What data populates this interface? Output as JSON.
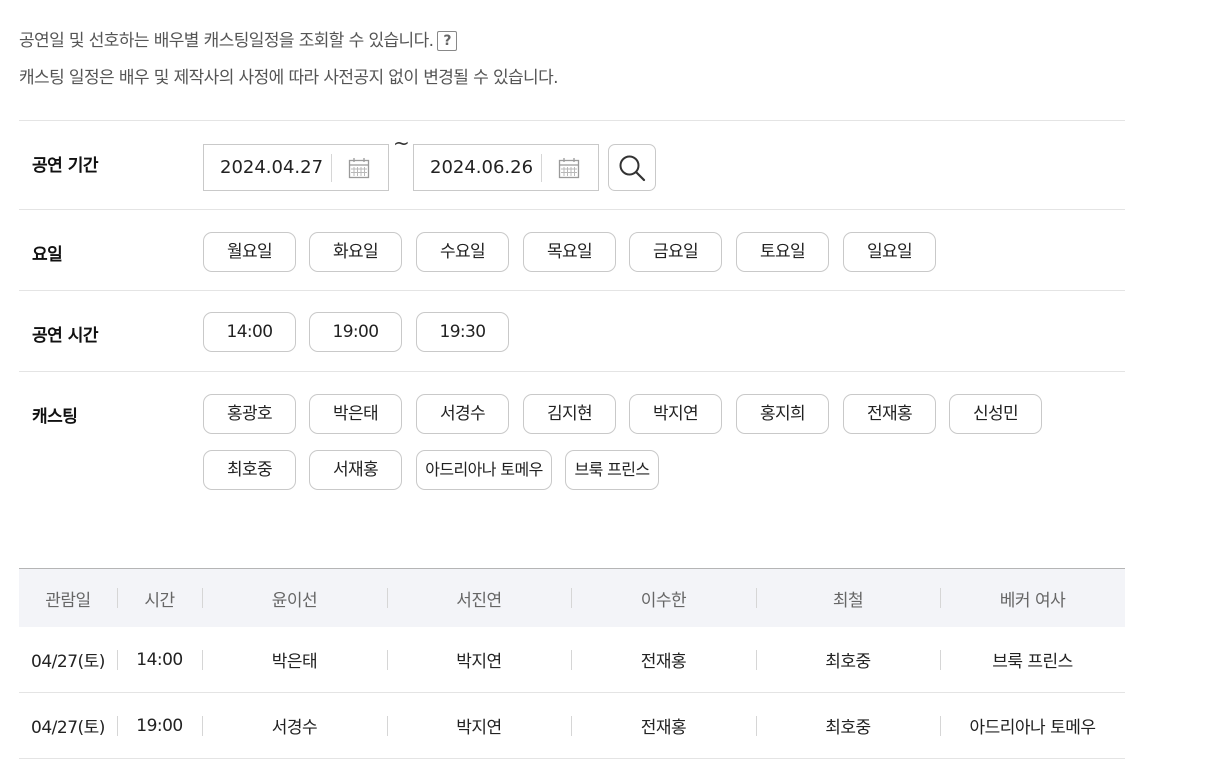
{
  "intro": {
    "line1": "공연일 및 선호하는 배우별 캐스팅일정을 조회할 수 있습니다.",
    "help_glyph": "?",
    "line2": "캐스팅 일정은 배우 및 제작사의 사정에 따라 사전공지 없이 변경될 수 있습니다."
  },
  "filters": {
    "period": {
      "label": "공연 기간",
      "start": "2024.04.27",
      "separator": "~",
      "end": "2024.06.26"
    },
    "weekday": {
      "label": "요일",
      "options": [
        "월요일",
        "화요일",
        "수요일",
        "목요일",
        "금요일",
        "토요일",
        "일요일"
      ]
    },
    "time": {
      "label": "공연 시간",
      "options": [
        "14:00",
        "19:00",
        "19:30"
      ]
    },
    "casting": {
      "label": "캐스팅",
      "row1": [
        "홍광호",
        "박은태",
        "서경수",
        "김지현",
        "박지연",
        "홍지희",
        "전재홍",
        "신성민"
      ],
      "row2": [
        "최호중",
        "서재홍",
        "아드리아나 토메우",
        "브룩 프린스"
      ]
    }
  },
  "table": {
    "headers": [
      "관람일",
      "시간",
      "윤이선",
      "서진연",
      "이수한",
      "최철",
      "베커 여사"
    ],
    "rows": [
      [
        "04/27(토)",
        "14:00",
        "박은태",
        "박지연",
        "전재홍",
        "최호중",
        "브룩 프린스"
      ],
      [
        "04/27(토)",
        "19:00",
        "서경수",
        "박지연",
        "전재홍",
        "최호중",
        "아드리아나 토메우"
      ]
    ]
  },
  "colors": {
    "accent": "#3d86e0",
    "border": "#c9c9c9",
    "header_bg": "#f3f4f8"
  }
}
